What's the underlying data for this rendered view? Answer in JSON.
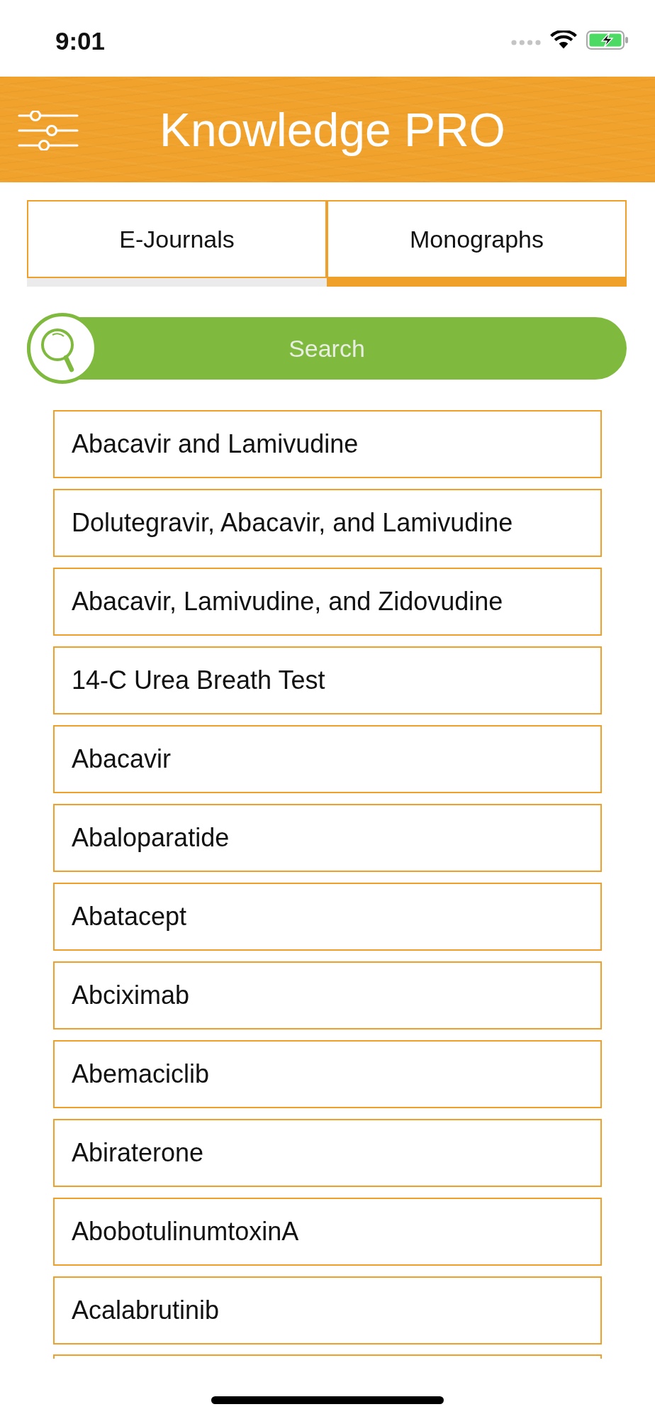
{
  "status_bar": {
    "time": "9:01"
  },
  "header": {
    "title": "Knowledge PRO"
  },
  "tabs": [
    {
      "label": "E-Journals",
      "selected": false
    },
    {
      "label": "Monographs",
      "selected": true
    }
  ],
  "search": {
    "placeholder": "Search"
  },
  "list": {
    "items": [
      "Abacavir and Lamivudine",
      "Dolutegravir, Abacavir, and Lamivudine",
      "Abacavir, Lamivudine, and Zidovudine",
      "14-C Urea Breath Test",
      "Abacavir",
      "Abaloparatide",
      "Abatacept",
      "Abciximab",
      "Abemaciclib",
      "Abiraterone",
      "AbobotulinumtoxinA",
      "Acalabrutinib"
    ],
    "more_below": true
  }
}
